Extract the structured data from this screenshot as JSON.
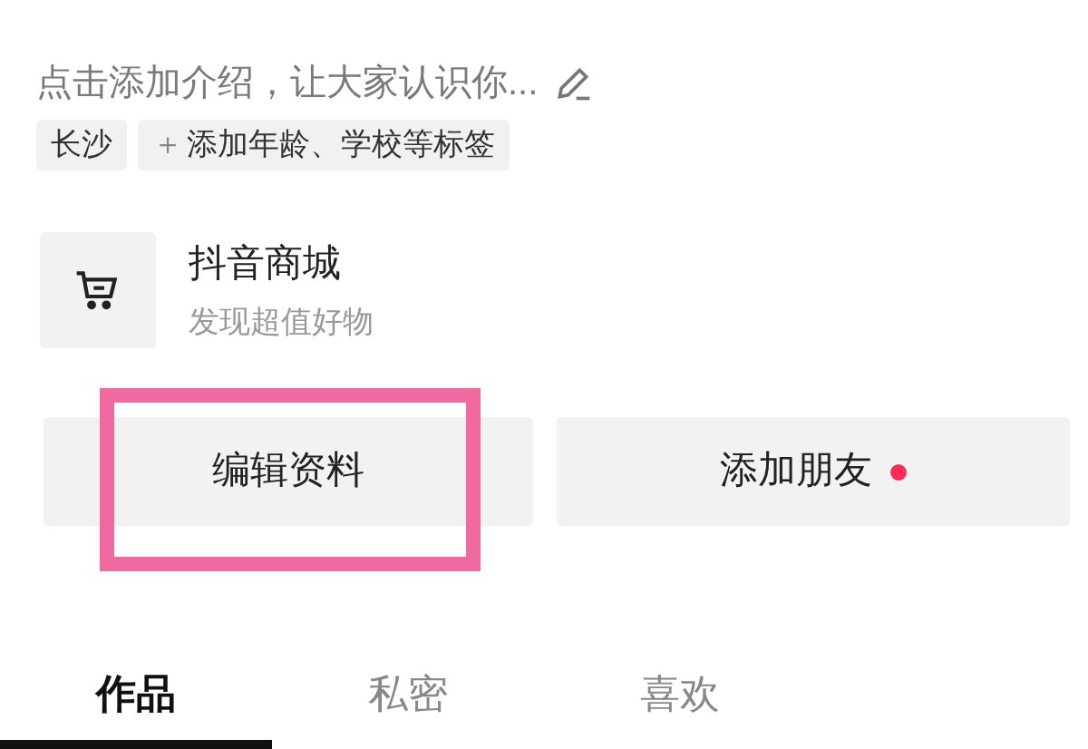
{
  "bio": {
    "placeholder": "点击添加介绍，让大家认识你..."
  },
  "tags": [
    {
      "kind": "location",
      "label": "长沙"
    },
    {
      "kind": "add",
      "icon": "＋",
      "label": "添加年龄、学校等标签"
    }
  ],
  "shop": {
    "title": "抖音商城",
    "subtitle": "发现超值好物"
  },
  "buttons": [
    {
      "label": "编辑资料",
      "highlighted": true,
      "badge": false
    },
    {
      "label": "添加朋友",
      "highlighted": false,
      "badge": true
    }
  ],
  "tabs": [
    {
      "label": "作品",
      "selected": true
    },
    {
      "label": "私密",
      "selected": false
    },
    {
      "label": "喜欢",
      "selected": false
    }
  ]
}
